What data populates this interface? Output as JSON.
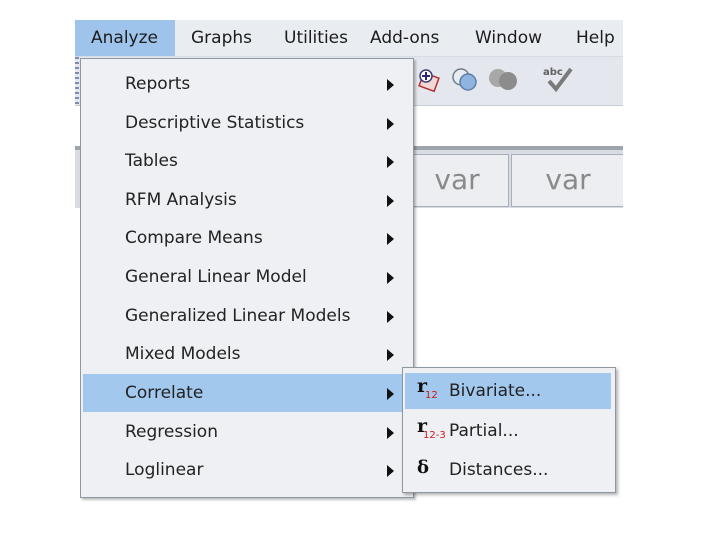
{
  "menubar": {
    "items": [
      {
        "label": "Analyze",
        "active": true
      },
      {
        "label": "Graphs"
      },
      {
        "label": "Utilities"
      },
      {
        "label": "Add-ons"
      },
      {
        "label": "Window"
      },
      {
        "label": "Help"
      }
    ]
  },
  "toolbar": {
    "icons": [
      "insert-cases-icon",
      "circles-icon",
      "dark-circles-icon",
      "spell-check-icon"
    ]
  },
  "data_view": {
    "columns": [
      "var",
      "var"
    ]
  },
  "analyze_menu": {
    "items": [
      {
        "label": "Reports",
        "has_submenu": true
      },
      {
        "label": "Descriptive Statistics",
        "has_submenu": true
      },
      {
        "label": "Tables",
        "has_submenu": true
      },
      {
        "label": "RFM Analysis",
        "has_submenu": true
      },
      {
        "label": "Compare Means",
        "has_submenu": true
      },
      {
        "label": "General Linear Model",
        "has_submenu": true
      },
      {
        "label": "Generalized Linear Models",
        "has_submenu": true
      },
      {
        "label": "Mixed Models",
        "has_submenu": true
      },
      {
        "label": "Correlate",
        "has_submenu": true,
        "highlighted": true
      },
      {
        "label": "Regression",
        "has_submenu": true
      },
      {
        "label": "Loglinear",
        "has_submenu": true
      }
    ]
  },
  "correlate_submenu": {
    "items": [
      {
        "label": "Bivariate...",
        "icon": "r12-icon",
        "icon_sub": "12",
        "highlighted": true
      },
      {
        "label": "Partial...",
        "icon": "r12-3-icon",
        "icon_sub": "12-3"
      },
      {
        "label": "Distances...",
        "icon": "delta-icon",
        "icon_glyph": "δ"
      }
    ]
  },
  "colors": {
    "menu_highlight": "#a3c8ee",
    "menu_background": "#eef0f3",
    "subscript_red": "#d01818"
  }
}
